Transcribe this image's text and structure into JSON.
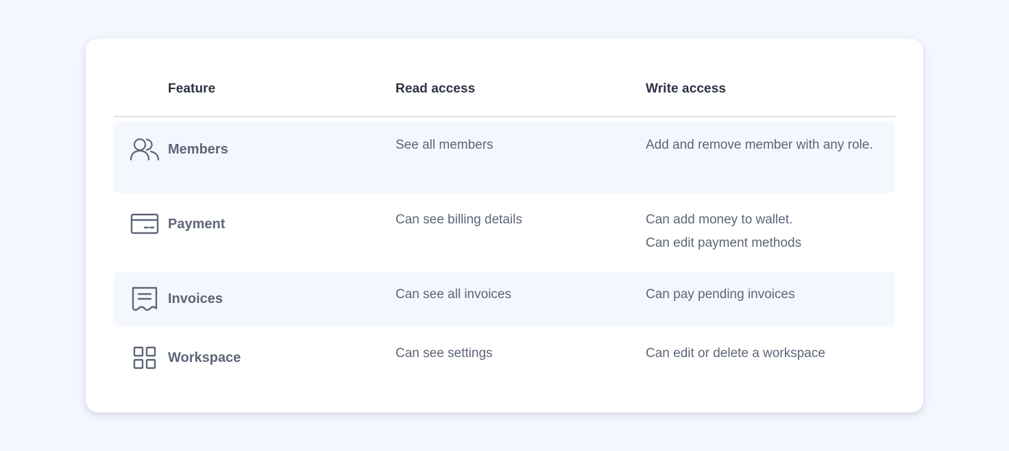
{
  "table": {
    "headers": {
      "feature": "Feature",
      "read": "Read access",
      "write": "Write access"
    },
    "rows": [
      {
        "feature": "Members",
        "icon": "users-icon",
        "read": "See all members",
        "write": "Add and remove member with any role."
      },
      {
        "feature": "Payment",
        "icon": "credit-card-icon",
        "read": "Can see billing details",
        "write_lines": [
          "Can add money to wallet.",
          "Can edit payment methods"
        ]
      },
      {
        "feature": "Invoices",
        "icon": "receipt-icon",
        "read": "Can see all invoices",
        "write": "Can pay pending invoices"
      },
      {
        "feature": "Workspace",
        "icon": "grid-icon",
        "read": "Can see settings",
        "write": "Can edit or delete a workspace"
      }
    ]
  },
  "colors": {
    "background": "#f4f7fe",
    "card": "#ffffff",
    "row_shade": "#f4f7fe",
    "header_text": "#2b3242",
    "body_text": "#5d6577",
    "divider": "#dfe2e8"
  }
}
